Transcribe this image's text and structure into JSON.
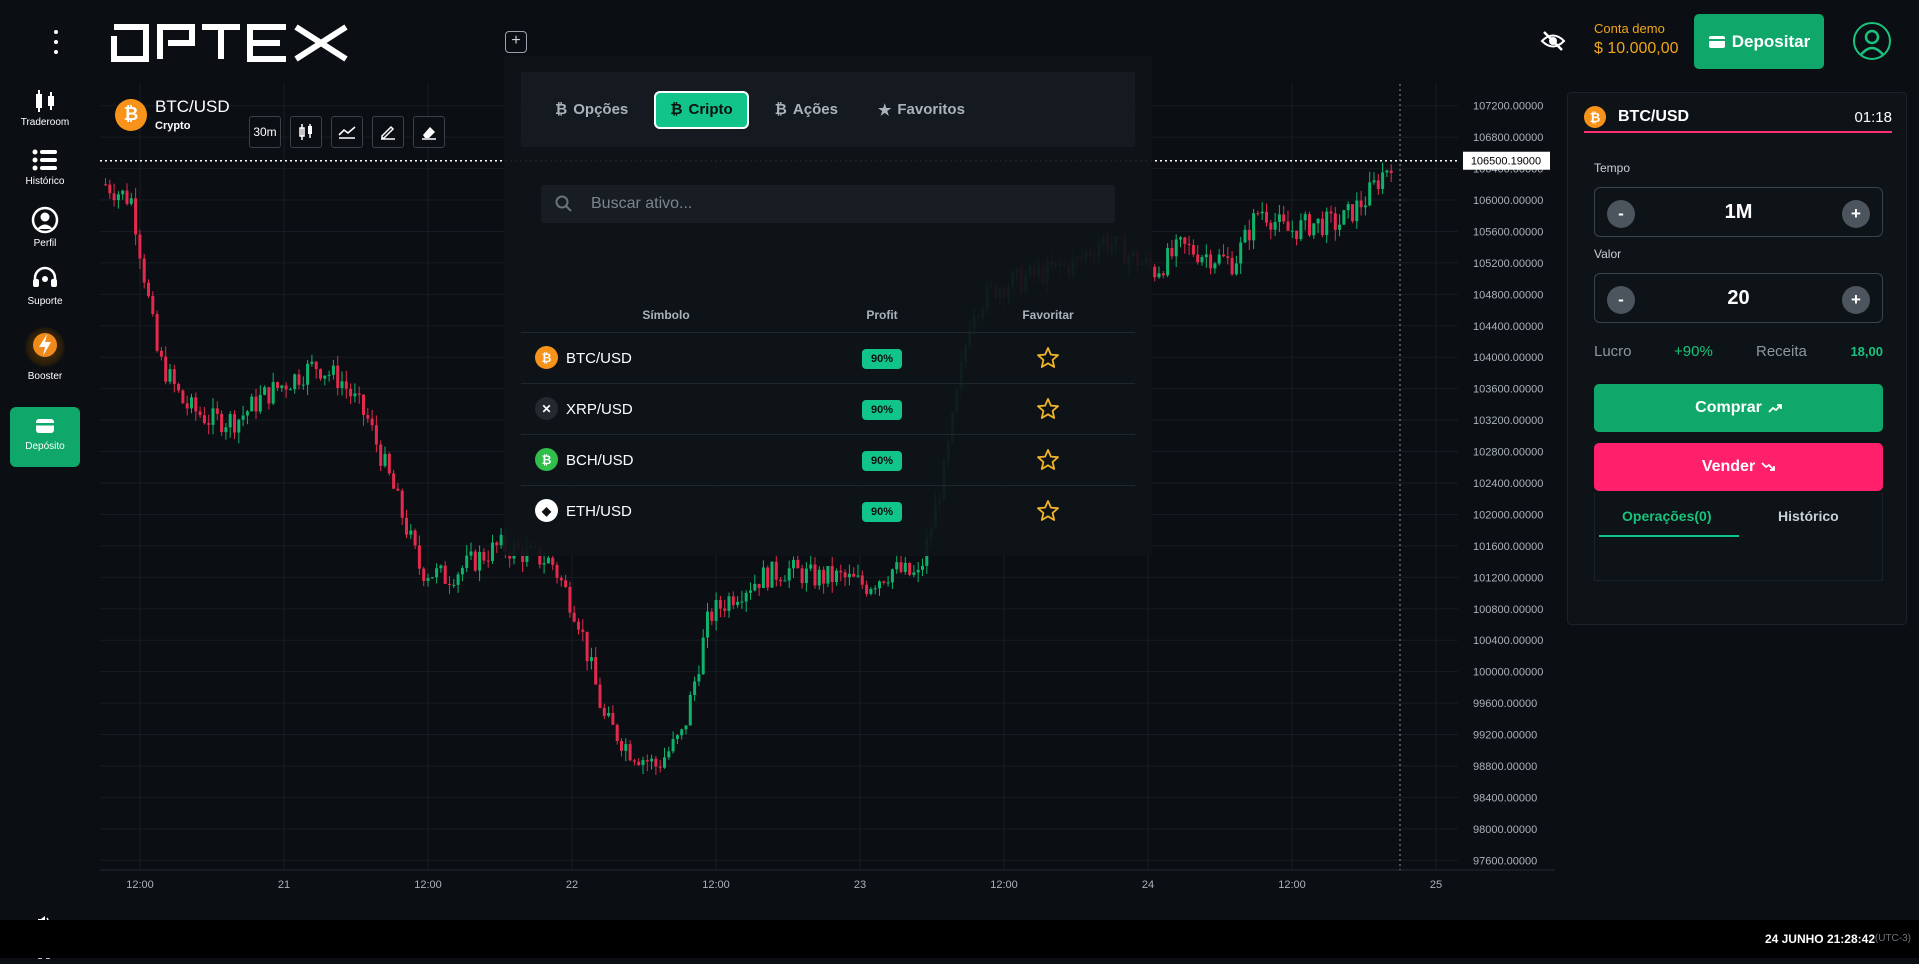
{
  "header": {
    "logo_text": "OPTEX",
    "demo_label": "Conta demo",
    "demo_balance": "$ 10.000,00",
    "deposit_label": "Depositar",
    "accent": "#0fa86a"
  },
  "sidebar": {
    "items": [
      {
        "label": "Traderoom",
        "icon": "candlestick-icon"
      },
      {
        "label": "Histórico",
        "icon": "list-icon"
      },
      {
        "label": "Perfil",
        "icon": "user-icon"
      },
      {
        "label": "Suporte",
        "icon": "headset-icon"
      },
      {
        "label": "Booster",
        "icon": "lightning-icon"
      },
      {
        "label": "Depósito",
        "icon": "wallet-icon"
      }
    ]
  },
  "chart": {
    "asset": "BTC/USD",
    "category": "Crypto",
    "timeframe": "30m",
    "current_price_label": "106500.19000",
    "up_color": "#10b26b",
    "down_color": "#e3294d"
  },
  "chart_data": {
    "type": "candlestick",
    "title": "BTC/USD",
    "ylim": [
      97400,
      107400
    ],
    "y_ticks": [
      "107200.00000",
      "106800.00000",
      "106400.00000",
      "106000.00000",
      "105600.00000",
      "105200.00000",
      "104800.00000",
      "104400.00000",
      "104000.00000",
      "103600.00000",
      "103200.00000",
      "102800.00000",
      "102400.00000",
      "102000.00000",
      "101600.00000",
      "101200.00000",
      "100800.00000",
      "100400.00000",
      "100000.00000",
      "99600.00000",
      "99200.00000",
      "98800.00000",
      "98400.00000",
      "98000.00000",
      "97600.00000"
    ],
    "x_ticks": [
      "12:00",
      "21",
      "12:00",
      "22",
      "12:00",
      "23",
      "12:00",
      "24",
      "12:00",
      "25"
    ],
    "last_price": 106500.19,
    "trend": [
      106200,
      106000,
      104000,
      103400,
      103200,
      103200,
      103500,
      103700,
      103900,
      103700,
      103200,
      102300,
      101300,
      101200,
      101400,
      101600,
      101500,
      101400,
      100700,
      99400,
      99000,
      98800,
      99200,
      100700,
      101000,
      101200,
      101300,
      101200,
      101200,
      101100,
      101300,
      101200,
      102600,
      104600,
      104900,
      105000,
      105100,
      105200,
      105500,
      105300,
      105100,
      105400,
      105300,
      105200,
      105900,
      105600,
      105700,
      105700,
      106000,
      106500
    ]
  },
  "selector": {
    "tabs": [
      {
        "label": "Opções",
        "active": false
      },
      {
        "label": "Cripto",
        "active": true
      },
      {
        "label": "Ações",
        "active": false
      },
      {
        "label": "Favoritos",
        "active": false
      }
    ],
    "search_placeholder": "Buscar ativo...",
    "columns": [
      "Símbolo",
      "Profit",
      "Favoritar"
    ],
    "rows": [
      {
        "symbol": "BTC/USD",
        "profit": "90%",
        "icon": "bitcoin-icon",
        "color": "#f7931a"
      },
      {
        "symbol": "XRP/USD",
        "profit": "90%",
        "icon": "xrp-icon",
        "color": "#23292f"
      },
      {
        "symbol": "BCH/USD",
        "profit": "90%",
        "icon": "bitcoin-cash-icon",
        "color": "#2fbf4a"
      },
      {
        "symbol": "ETH/USD",
        "profit": "90%",
        "icon": "ethereum-icon",
        "color": "#ffffff"
      }
    ]
  },
  "panel": {
    "asset": "BTC/USD",
    "countdown": "01:18",
    "time_label": "Tempo",
    "time_value": "1M",
    "amount_label": "Valor",
    "amount_value": "20",
    "minus": "-",
    "plus": "+",
    "profit_label": "Lucro",
    "profit_value": "+90%",
    "return_label": "Receita",
    "return_value": "18,00",
    "buy_label": "Comprar",
    "sell_label": "Vender",
    "tab_operations": "Operações(0)",
    "tab_history": "Histórico"
  },
  "footer": {
    "datetime": "24 JUNHO 21:28:42",
    "timezone": "(UTC-3)"
  }
}
